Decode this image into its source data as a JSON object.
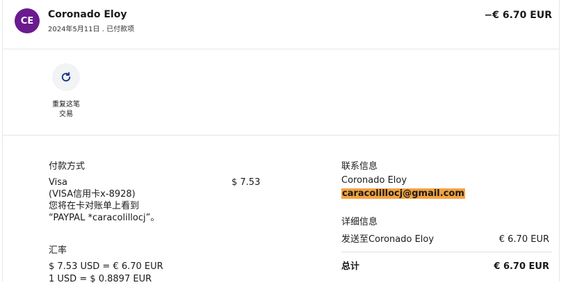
{
  "header": {
    "avatar_initials": "CE",
    "name": "Coronado Eloy",
    "subline": "2024年5月11日 . 已付款项",
    "amount": "−€ 6.70 EUR"
  },
  "repeat": {
    "label_line1": "重复这笔",
    "label_line2": "交易"
  },
  "payment": {
    "title": "付款方式",
    "method_line1": "Visa",
    "method_line2": "(VISA信用卡x-8928)",
    "method_line3": "您将在卡对账单上看到",
    "method_line4": "“PAYPAL *caracolillocj”。",
    "amount": "$ 7.53"
  },
  "exchange": {
    "title": "汇率",
    "line1": "$ 7.53 USD = € 6.70 EUR",
    "line2": "1 USD = $ 0.8897 EUR"
  },
  "contact": {
    "title": "联系信息",
    "name": "Coronado Eloy",
    "email": "caracolillocj@gmail.com"
  },
  "details": {
    "title": "详细信息",
    "sent_to_label": "发送至Coronado Eloy",
    "sent_to_amount": "€ 6.70 EUR",
    "total_label": "总计",
    "total_amount": "€ 6.70 EUR"
  },
  "colors": {
    "avatar_bg": "#6a1b8f",
    "email_highlight": "#f4a340"
  }
}
